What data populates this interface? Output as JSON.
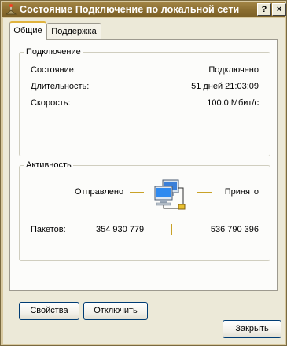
{
  "window": {
    "title": "Состояние Подключение по локальной сети",
    "help_glyph": "?",
    "close_glyph": "×"
  },
  "tabs": [
    {
      "label": "Общие",
      "active": true
    },
    {
      "label": "Поддержка",
      "active": false
    }
  ],
  "connection": {
    "legend": "Подключение",
    "status_label": "Состояние:",
    "status_value": "Подключено",
    "duration_label": "Длительность:",
    "duration_value": "51 дней 21:03:09",
    "speed_label": "Скорость:",
    "speed_value": "100.0 Мбит/с"
  },
  "activity": {
    "legend": "Активность",
    "sent_label": "Отправлено",
    "received_label": "Принято",
    "packets_label": "Пакетов:",
    "packets_sent": "354 930 779",
    "packets_received": "536 790 396"
  },
  "buttons": {
    "properties": "Свойства",
    "disable": "Отключить",
    "close": "Закрыть"
  },
  "colors": {
    "titlebar": "#8a6d30",
    "face": "#ece9d8",
    "accent_line": "#c9a227"
  },
  "icons": {
    "title": "network-connection-icon",
    "activity": "network-computers-icon"
  }
}
